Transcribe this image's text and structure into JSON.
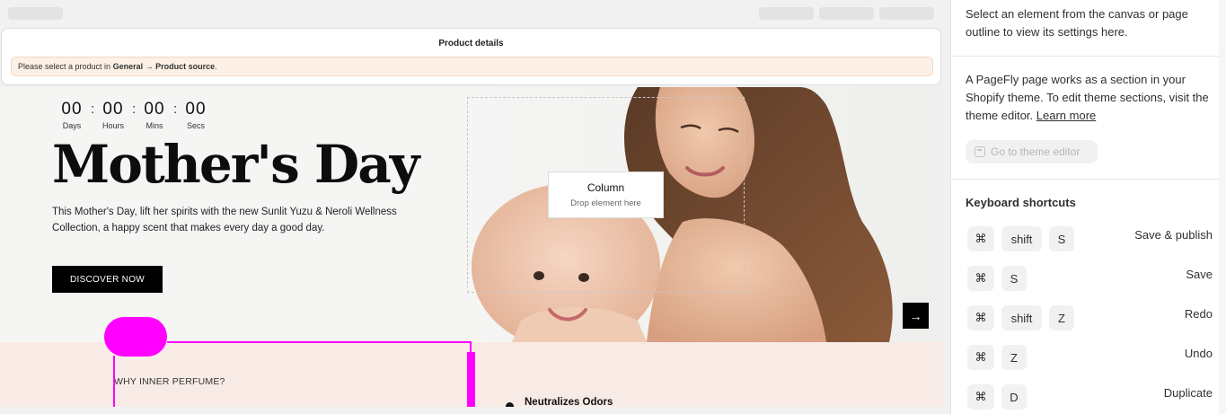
{
  "product_panel": {
    "title": "Product details",
    "notice_prefix": "Please select a product in ",
    "notice_path": "General → Product source",
    "notice_suffix": "."
  },
  "hero": {
    "countdown": [
      {
        "value": "00",
        "label": "Days"
      },
      {
        "value": "00",
        "label": "Hours"
      },
      {
        "value": "00",
        "label": "Mins"
      },
      {
        "value": "00",
        "label": "Secs"
      }
    ],
    "separator": ":",
    "title": "Mother's Day",
    "description": "This Mother's Day, lift her spirits with the new Sunlit Yuzu & Neroli Wellness Collection, a happy scent that makes every day a good day.",
    "cta_label": "DISCOVER NOW",
    "column_label": "Column",
    "column_placeholder": "Drop element here",
    "next_icon": "arrow-right-icon"
  },
  "section2": {
    "eyebrow": "WHY INNER PERFUME?",
    "feature_title": "Neutralizes Odors"
  },
  "sidebar": {
    "intro": "Select an element from the canvas or page outline to view its settings here.",
    "theme_info": "A PageFly page works as a section in your Shopify theme. To edit theme sections, visit the theme editor.",
    "learn_more": "Learn more",
    "theme_button": "Go to theme editor",
    "shortcuts_title": "Keyboard shortcuts",
    "shortcuts": [
      {
        "keys": [
          "⌘",
          "shift",
          "S"
        ],
        "label": "Save & publish"
      },
      {
        "keys": [
          "⌘",
          "S"
        ],
        "label": "Save"
      },
      {
        "keys": [
          "⌘",
          "shift",
          "Z"
        ],
        "label": "Redo"
      },
      {
        "keys": [
          "⌘",
          "Z"
        ],
        "label": "Undo"
      },
      {
        "keys": [
          "⌘",
          "D"
        ],
        "label": "Duplicate"
      }
    ]
  },
  "colors": {
    "accent_overlay": "#ff00ff",
    "notice_bg": "#fdf0e6",
    "section_bg": "#f8ebe6",
    "cta_bg": "#000000"
  }
}
